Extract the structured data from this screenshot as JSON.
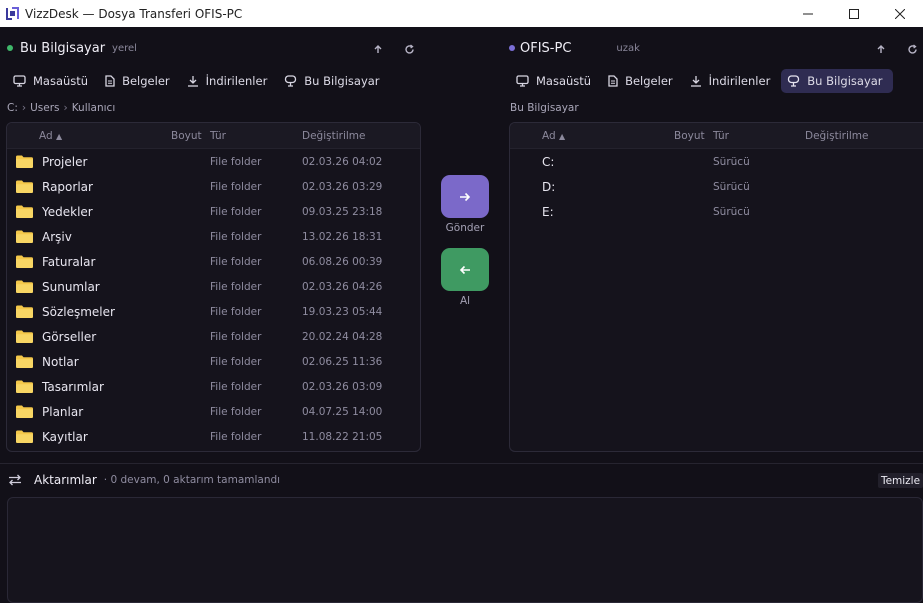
{
  "window": {
    "title": "VizzDesk — Dosya Transferi OFIS-PC"
  },
  "local": {
    "name": "Bu Bilgisayar",
    "tag": "yerel",
    "dot_color": "#3fb86a",
    "quicknav": [
      {
        "label": "Masaüstü",
        "icon": "monitor-icon"
      },
      {
        "label": "Belgeler",
        "icon": "document-icon"
      },
      {
        "label": "İndirilenler",
        "icon": "download-icon"
      },
      {
        "label": "Bu Bilgisayar",
        "icon": "computer-icon"
      }
    ],
    "breadcrumb": [
      "C:",
      "Users",
      "Kullanıcı"
    ],
    "columns": {
      "name": "Ad",
      "size": "Boyut",
      "type": "Tür",
      "modified": "Değiştirilme"
    },
    "rows": [
      {
        "name": "Projeler",
        "type": "File folder",
        "date": "02.03.26 04:02"
      },
      {
        "name": "Raporlar",
        "type": "File folder",
        "date": "02.03.26 03:29"
      },
      {
        "name": "Yedekler",
        "type": "File folder",
        "date": "09.03.25 23:18"
      },
      {
        "name": "Arşiv",
        "type": "File folder",
        "date": "13.02.26 18:31"
      },
      {
        "name": "Faturalar",
        "type": "File folder",
        "date": "06.08.26 00:39"
      },
      {
        "name": "Sunumlar",
        "type": "File folder",
        "date": "02.03.26 04:26"
      },
      {
        "name": "Sözleşmeler",
        "type": "File folder",
        "date": "19.03.23 05:44"
      },
      {
        "name": "Görseller",
        "type": "File folder",
        "date": "20.02.24 04:28"
      },
      {
        "name": "Notlar",
        "type": "File folder",
        "date": "02.06.25 11:36"
      },
      {
        "name": "Tasarımlar",
        "type": "File folder",
        "date": "02.03.26 03:09"
      },
      {
        "name": "Planlar",
        "type": "File folder",
        "date": "04.07.25 14:00"
      },
      {
        "name": "Kayıtlar",
        "type": "File folder",
        "date": "11.08.22 21:05"
      }
    ]
  },
  "remote": {
    "name": "OFIS-PC",
    "tag": "uzak",
    "dot_color": "#7b6fd6",
    "quicknav": [
      {
        "label": "Masaüstü",
        "icon": "monitor-icon"
      },
      {
        "label": "Belgeler",
        "icon": "document-icon"
      },
      {
        "label": "İndirilenler",
        "icon": "download-icon"
      },
      {
        "label": "Bu Bilgisayar",
        "icon": "computer-icon",
        "active": true
      }
    ],
    "breadcrumb": "Bu Bilgisayar",
    "columns": {
      "name": "Ad",
      "size": "Boyut",
      "type": "Tür",
      "modified": "Değiştirilme"
    },
    "rows": [
      {
        "name": "C:",
        "type": "Sürücü"
      },
      {
        "name": "D:",
        "type": "Sürücü"
      },
      {
        "name": "E:",
        "type": "Sürücü"
      }
    ]
  },
  "actions": {
    "send_label": "Gönder",
    "send_color": "#7b69c9",
    "receive_label": "Al",
    "receive_color": "#3f9a62"
  },
  "transfers": {
    "title": "Aktarımlar",
    "status": "· 0 devam,  0 aktarım tamamlandı",
    "clear_label": "Temizle"
  },
  "accent": {
    "folder": "#f4c84a",
    "active_nav": "#2f2c52"
  }
}
